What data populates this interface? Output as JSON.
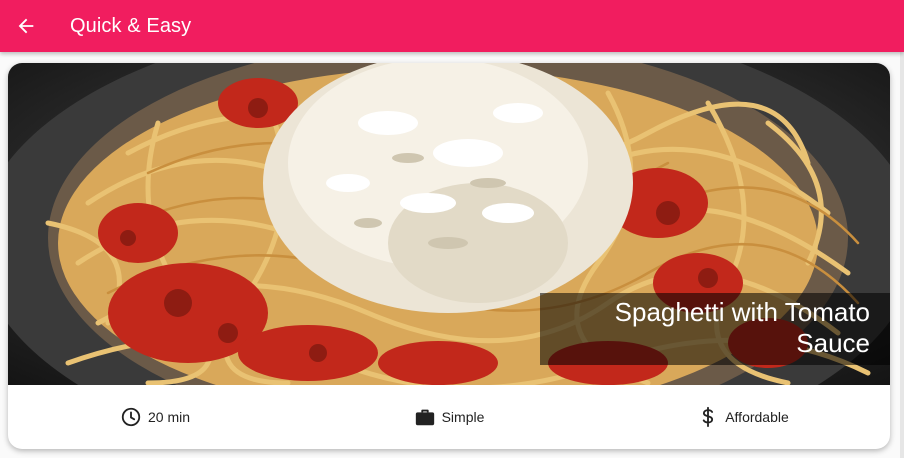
{
  "appbar": {
    "title": "Quick & Easy",
    "back_icon": "arrow-back-icon",
    "color": "#f11d5f"
  },
  "recipe": {
    "title": "Spaghetti with Tomato Sauce",
    "image": "spaghetti-photo",
    "duration": "20 min",
    "complexity": "Simple",
    "affordability": "Affordable",
    "duration_icon": "clock-icon",
    "complexity_icon": "briefcase-icon",
    "affordability_icon": "dollar-icon"
  }
}
